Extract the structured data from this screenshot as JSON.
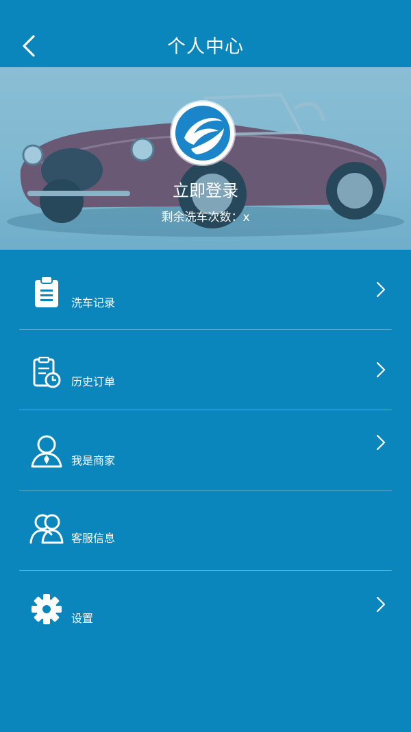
{
  "header": {
    "title": "个人中心"
  },
  "profile": {
    "login_label": "立即登录",
    "wash_count_text": "剩余洗车次数：x"
  },
  "menu": [
    {
      "label": "洗车记录",
      "icon": "clipboard-icon",
      "has_chevron": true
    },
    {
      "label": "历史订单",
      "icon": "order-history-icon",
      "has_chevron": true
    },
    {
      "label": "我是商家",
      "icon": "merchant-user-icon",
      "has_chevron": true
    },
    {
      "label": "客服信息",
      "icon": "customer-service-icon",
      "has_chevron": false
    },
    {
      "label": "设置",
      "icon": "gear-icon",
      "has_chevron": true
    }
  ],
  "colors": {
    "primary": "#0a86bd",
    "text": "#ffffff"
  }
}
